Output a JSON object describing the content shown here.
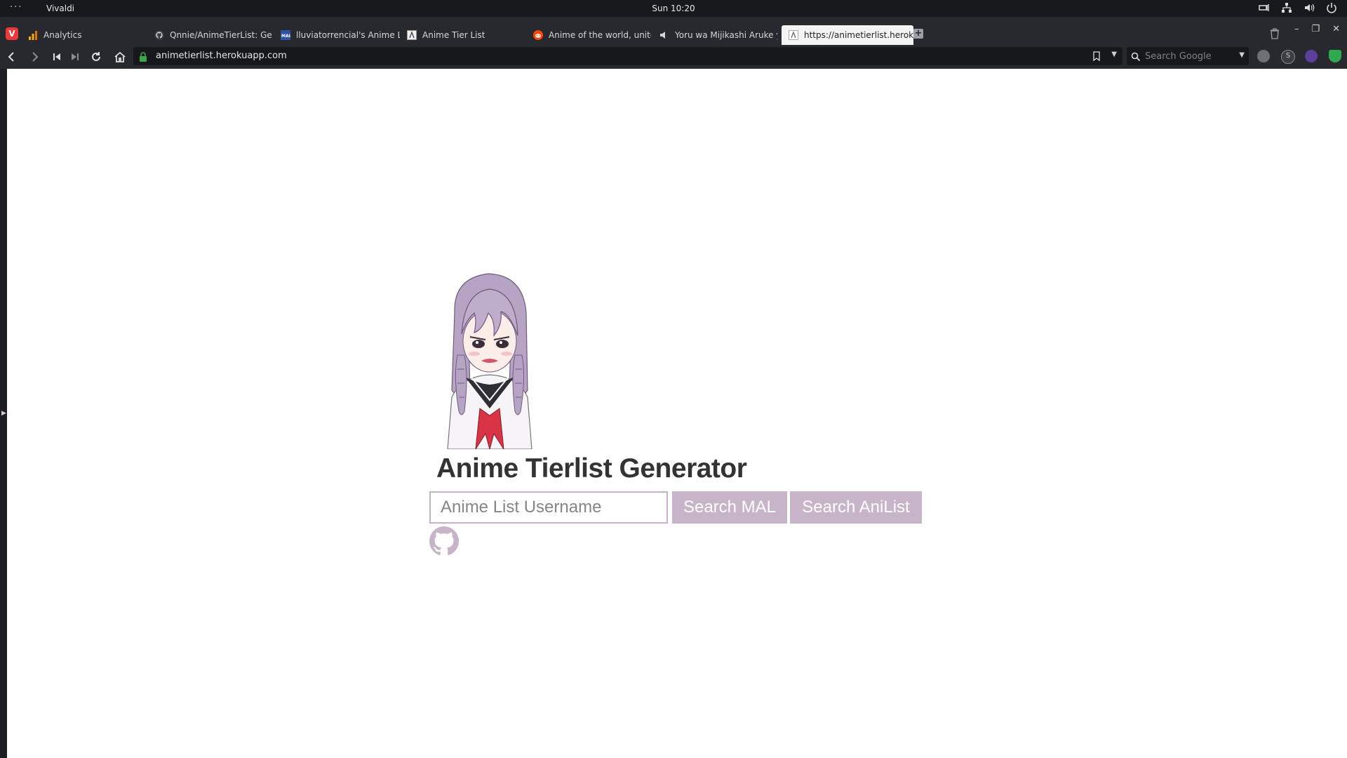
{
  "system": {
    "app_name": "Vivaldi",
    "clock": "Sun 10:20"
  },
  "browser": {
    "tabs": [
      {
        "label": "Analytics",
        "icon": "analytics-icon"
      },
      {
        "label": "Qnnie/AnimeTierList: Gen",
        "icon": "github-icon"
      },
      {
        "label": "lluviatorrencial's Anime Lis",
        "icon": "mal-icon"
      },
      {
        "label": "Anime Tier List",
        "icon": "page-icon"
      },
      {
        "label": "Anime of the world, unite!",
        "icon": "reddit-icon"
      },
      {
        "label": "Yoru wa Mijikashi Aruke yo",
        "icon": "speaker-icon"
      },
      {
        "label": "https://animetierlist.herok",
        "icon": "page-icon",
        "active": true
      }
    ],
    "url": "animetierlist.herokuapp.com",
    "search_placeholder": "Search Google"
  },
  "page": {
    "title": "Anime Tierlist Generator",
    "username_placeholder": "Anime List Username",
    "username_value": "",
    "search_mal_label": "Search MAL",
    "search_anilist_label": "Search AniList",
    "github_icon": "github-icon"
  },
  "colors": {
    "accent": "#c8b4c9",
    "input_border": "#c4b2c6",
    "title": "#333333",
    "chrome_dark": "#27292e"
  }
}
